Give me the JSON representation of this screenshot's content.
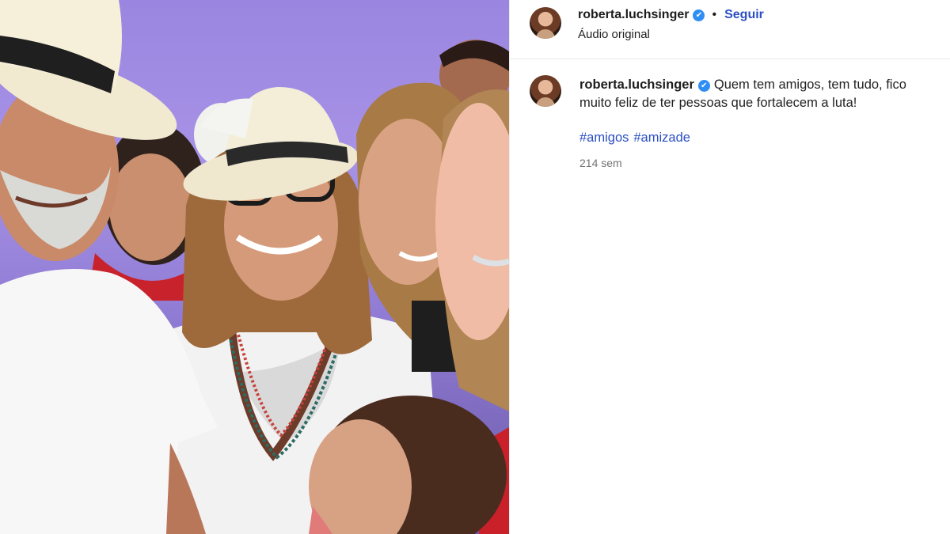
{
  "post": {
    "username": "roberta.luchsinger",
    "follow_label": "Seguir",
    "separator": "•",
    "audio_label": "Áudio original",
    "verified_glyph": "✔",
    "photo_icon": "group-photo",
    "caption": {
      "username": "roberta.luchsinger",
      "text": "Quem tem amigos, tem tudo, fico muito feliz de ter pessoas que fortalecem a luta!",
      "hashtags": [
        "#amigos",
        "#amizade"
      ],
      "time_ago": "214 sem"
    },
    "colors": {
      "link": "#2b4fc4",
      "verified": "#2f8ef5",
      "muted": "#737373",
      "background": "#7f6cc9"
    }
  }
}
